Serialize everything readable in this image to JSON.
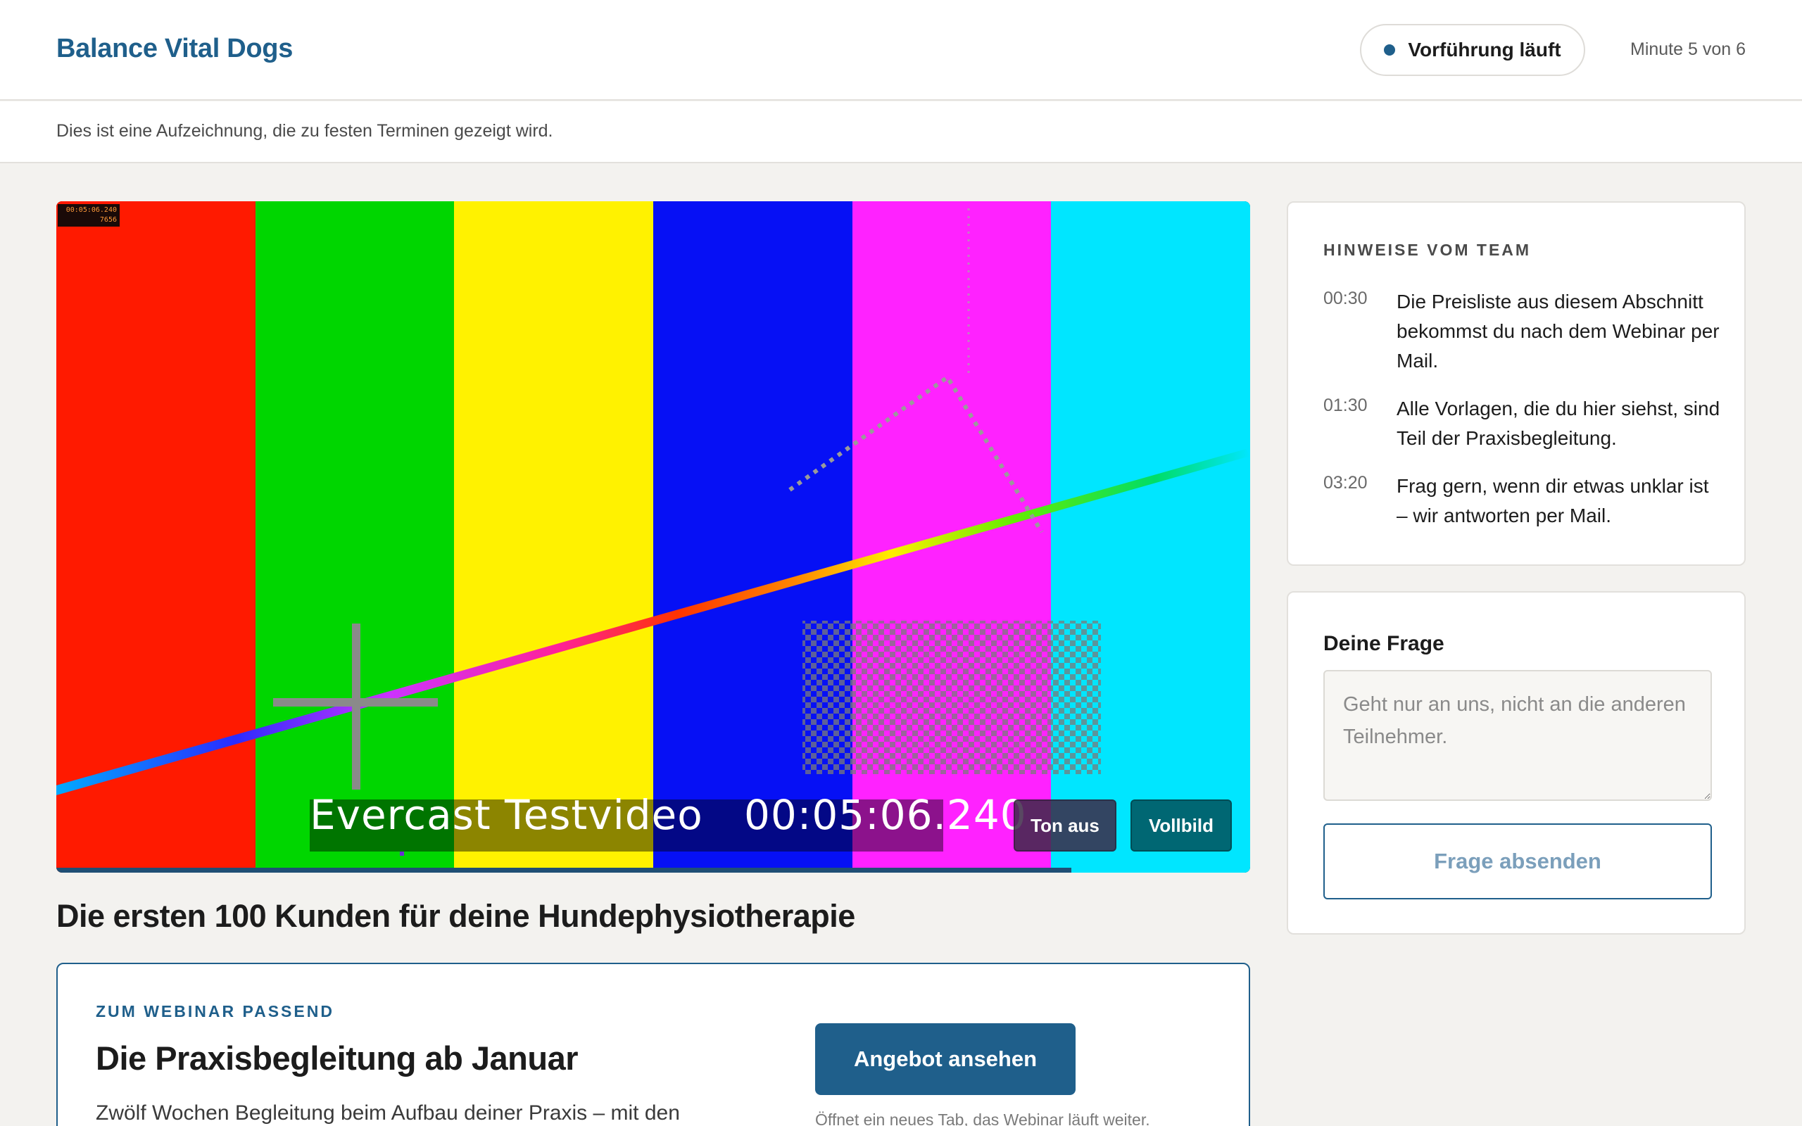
{
  "header": {
    "brand": "Balance Vital Dogs",
    "status": "Vorführung läuft",
    "minute_info": "Minute 5 von 6"
  },
  "subheader": {
    "text": "Dies ist eine Aufzeichnung, die zu festen Terminen gezeigt wird."
  },
  "video": {
    "bar_colors": [
      "#ff1a00",
      "#00d600",
      "#fff200",
      "#0610f5",
      "#ff22ff",
      "#00e6ff"
    ],
    "corner_timecode": "00:05:06.240",
    "corner_frame": "7656",
    "caption": "Evercast Testvideo   00:05:06.240",
    "mute_label": "Ton aus",
    "fullscreen_label": "Vollbild",
    "progress": 0.85
  },
  "webinar_title": "Die ersten 100 Kunden für deine Hundephysiotherapie",
  "offer": {
    "kicker": "ZUM WEBINAR PASSEND",
    "title": "Die Praxisbegleitung ab Januar",
    "description": "Zwölf Wochen Begleitung beim Aufbau deiner Praxis – mit den",
    "button_label": "Angebot ansehen",
    "note": "Öffnet ein neues Tab, das Webinar läuft weiter."
  },
  "notes": {
    "heading": "HINWEISE VOM TEAM",
    "items": [
      {
        "time": "00:30",
        "text": "Die Preisliste aus diesem Abschnitt bekommst du nach dem Webinar per Mail."
      },
      {
        "time": "01:30",
        "text": "Alle Vorlagen, die du hier siehst, sind Teil der Praxisbegleitung."
      },
      {
        "time": "03:20",
        "text": "Frag gern, wenn dir etwas unklar ist – wir antworten per Mail."
      }
    ]
  },
  "question": {
    "label": "Deine Frage",
    "placeholder": "Geht nur an uns, nicht an die anderen Teilnehmer.",
    "submit_label": "Frage absenden"
  },
  "colors": {
    "accent": "#1f5f8b",
    "background": "#f3f2ef"
  }
}
